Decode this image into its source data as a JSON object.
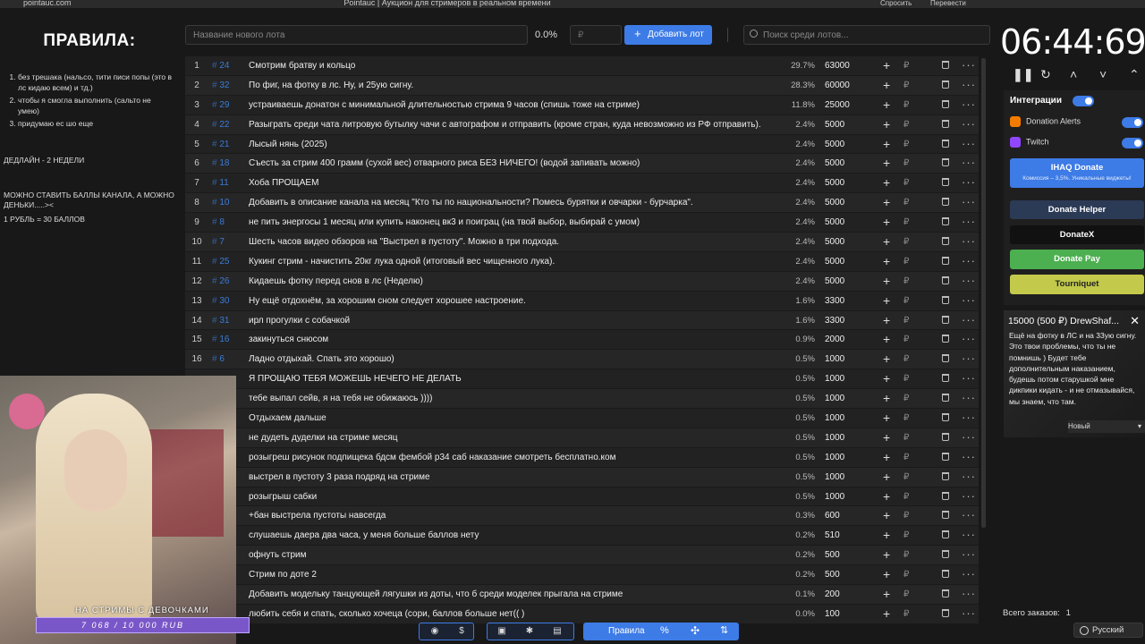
{
  "browser": {
    "url": "pointauc.com",
    "title": "Pointauc | Аукцион для стримеров в реальном времени",
    "ext_ask": "Спросить",
    "ext_translate": "Перевести"
  },
  "rules": {
    "title": "ПРАВИЛА:",
    "items": [
      "без трешака (нальсо, тити писи попы (это в лс кидаю всем) и тд.)",
      "чтобы я смогла выполнить (сальто не умею)",
      "придумаю ес шо еще"
    ],
    "deadline": "ДЕДЛАЙН - 2 НЕДЕЛИ",
    "points_line1": "МОЖНО СТАВИТЬ БАЛЛЫ КАНАЛА, А МОЖНО ДЕНЬКИ.....><",
    "points_line2": "1 РУБЛЬ = 30 БАЛЛОВ"
  },
  "toolbar": {
    "lot_placeholder": "Название нового лота",
    "percent": "0.0%",
    "amount_placeholder": "₽",
    "add_label": "Добавить лот",
    "search_placeholder": "Поиск среди лотов..."
  },
  "lots": [
    {
      "idx": "1",
      "id": "24",
      "name": "Смотрим братву и кольцо",
      "pct": "29.7%",
      "amount": "63000"
    },
    {
      "idx": "2",
      "id": "32",
      "name": "По фиг, на фотку в лс. Ну, и 25ую сигну.",
      "pct": "28.3%",
      "amount": "60000"
    },
    {
      "idx": "3",
      "id": "29",
      "name": "устраиваешь донатон с минимальной длительностью стрима 9 часов (спишь тоже на стриме)",
      "pct": "11.8%",
      "amount": "25000"
    },
    {
      "idx": "4",
      "id": "22",
      "name": "Разыграть среди чата литровую бутылку чачи с автографом и отправить (кроме стран, куда невозможно из РФ отправить).",
      "pct": "2.4%",
      "amount": "5000"
    },
    {
      "idx": "5",
      "id": "21",
      "name": "Лысый нянь (2025)",
      "pct": "2.4%",
      "amount": "5000"
    },
    {
      "idx": "6",
      "id": "18",
      "name": "Съесть за стрим 400 грамм (сухой вес) отварного риса БЕЗ НИЧЕГО! (водой запивать можно)",
      "pct": "2.4%",
      "amount": "5000"
    },
    {
      "idx": "7",
      "id": "11",
      "name": "Хоба ПРОЩАЕМ",
      "pct": "2.4%",
      "amount": "5000"
    },
    {
      "idx": "8",
      "id": "10",
      "name": "Добавить в описание канала на месяц \"Кто ты по национальности? Помесь бурятки и овчарки - бурчарка\".",
      "pct": "2.4%",
      "amount": "5000"
    },
    {
      "idx": "9",
      "id": "8",
      "name": "не пить энергосы 1 месяц или купить наконец вк3 и поиграц (на твой выбор, выбирай с умом)",
      "pct": "2.4%",
      "amount": "5000"
    },
    {
      "idx": "10",
      "id": "7",
      "name": "Шесть часов видео обзоров на \"Выстрел в пустоту\". Можно в три подхода.",
      "pct": "2.4%",
      "amount": "5000"
    },
    {
      "idx": "11",
      "id": "25",
      "name": "Кукинг стрим - начистить 20кг лука одной (итоговый вес чищенного лука).",
      "pct": "2.4%",
      "amount": "5000"
    },
    {
      "idx": "12",
      "id": "26",
      "name": "Кидаешь фотку перед снов в лс (Неделю)",
      "pct": "2.4%",
      "amount": "5000"
    },
    {
      "idx": "13",
      "id": "30",
      "name": "Ну ещё отдохнём, за хорошим сном следует хорошее настроение.",
      "pct": "1.6%",
      "amount": "3300"
    },
    {
      "idx": "14",
      "id": "31",
      "name": "ирл прогулки с собачкой",
      "pct": "1.6%",
      "amount": "3300"
    },
    {
      "idx": "15",
      "id": "16",
      "name": "закинуться снюсом",
      "pct": "0.9%",
      "amount": "2000"
    },
    {
      "idx": "16",
      "id": "6",
      "name": "Ладно отдыхай. Спать это хорошо)",
      "pct": "0.5%",
      "amount": "1000"
    },
    {
      "idx": "",
      "id": "",
      "name": "Я ПРОЩАЮ ТЕБЯ МОЖЕШЬ НЕЧЕГО НЕ ДЕЛАТЬ",
      "pct": "0.5%",
      "amount": "1000"
    },
    {
      "idx": "",
      "id": "",
      "name": "тебе выпал сейв, я на тебя не обижаюсь ))))",
      "pct": "0.5%",
      "amount": "1000"
    },
    {
      "idx": "",
      "id": "",
      "name": "Отдыхаем дальше",
      "pct": "0.5%",
      "amount": "1000"
    },
    {
      "idx": "",
      "id": "",
      "name": "не дудеть дуделки на стриме месяц",
      "pct": "0.5%",
      "amount": "1000"
    },
    {
      "idx": "",
      "id": "",
      "name": "розыгреш рисунок подпищека бдсм фембой р34 саб наказание смотреть бесплатно.ком",
      "pct": "0.5%",
      "amount": "1000"
    },
    {
      "idx": "",
      "id": "",
      "name": "выстрел в пустоту 3 раза подряд на стриме",
      "pct": "0.5%",
      "amount": "1000"
    },
    {
      "idx": "",
      "id": "",
      "name": "розыгрыш сабки",
      "pct": "0.5%",
      "amount": "1000"
    },
    {
      "idx": "",
      "id": "",
      "name": "+бан выстрела пустоты навсегда",
      "pct": "0.3%",
      "amount": "600"
    },
    {
      "idx": "",
      "id": "",
      "name": "слушаешь даера два часа, у меня больше баллов нету",
      "pct": "0.2%",
      "amount": "510"
    },
    {
      "idx": "",
      "id": "",
      "name": "офнуть стрим",
      "pct": "0.2%",
      "amount": "500"
    },
    {
      "idx": "",
      "id": "",
      "name": "Стрим по доте 2",
      "pct": "0.2%",
      "amount": "500"
    },
    {
      "idx": "",
      "id": "",
      "name": "Добавить модельку танцующей лягушки из доты, что б среди моделек прыгала на стриме",
      "pct": "0.1%",
      "amount": "200"
    },
    {
      "idx": "",
      "id": "",
      "name": "любить себя и спать, сколько хочеца (сори, баллов больше нет(( )",
      "pct": "0.0%",
      "amount": "100"
    }
  ],
  "currency_symbol": "₽",
  "overlay": {
    "title": "НА СТРИМЫ С ДЕВОЧКАМИ",
    "goal": "7 068 / 10 000 RUB"
  },
  "bottom": {
    "rules_label": "Правила"
  },
  "timer": {
    "value": "06:44:69"
  },
  "integrations": {
    "title": "Интеграции",
    "donation_alerts": "Donation Alerts",
    "twitch": "Twitch",
    "ihaq_title": "IHAQ Donate",
    "ihaq_sub": "Комиссия – 3,5%. Уникальные виджеты!",
    "donate_helper": "Donate Helper",
    "donatex": "DonateX",
    "donate_pay": "Donate Pay",
    "tourniquet": "Tourniquet"
  },
  "alert": {
    "header": "15000 (500 ₽) DrewShaf...",
    "body": "Ещё на фотку в ЛС и на 33ую сигну. Это твои проблемы, что ты не помнишь ) Будет тебе дополнительным наказанием, будешь потом старушкой мне дикпики кидать - и не отмазывайся, мы знаем, что там.",
    "select_value": "Новый"
  },
  "footer": {
    "orders_label": "Всего заказов:",
    "orders_count": "1",
    "language": "Русский"
  },
  "colors": {
    "accent": "#3d7be6",
    "lot_id": "#3a7bd5",
    "donate_pay": "#4caf50",
    "tourniquet": "#c3c94a",
    "overlay_bar": "#7a57c9"
  }
}
